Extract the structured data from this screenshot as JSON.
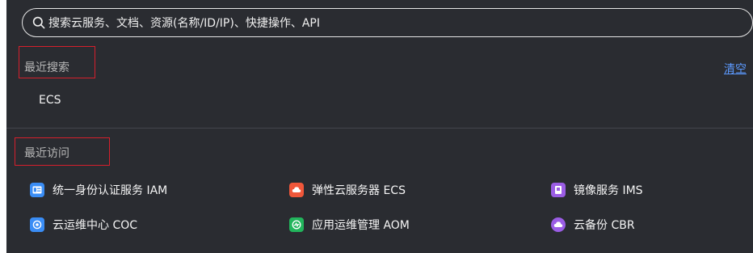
{
  "search": {
    "placeholder": "搜索云服务、文档、资源(名称/ID/IP)、快捷操作、API"
  },
  "recent_search": {
    "title": "最近搜索",
    "clear_label": "清空",
    "items": [
      {
        "label": "ECS"
      }
    ]
  },
  "recent_visit": {
    "title": "最近访问",
    "items": [
      {
        "label": "统一身份认证服务 IAM",
        "icon": "id-card-icon",
        "color": "#3a8df5"
      },
      {
        "label": "弹性云服务器 ECS",
        "icon": "cloud-server-icon",
        "color": "#f0573a"
      },
      {
        "label": "镜像服务 IMS",
        "icon": "image-icon",
        "color": "#9b5de5"
      },
      {
        "label": "云运维中心 COC",
        "icon": "ops-center-icon",
        "color": "#3a8df5"
      },
      {
        "label": "应用运维管理 AOM",
        "icon": "app-monitor-icon",
        "color": "#22b55c"
      },
      {
        "label": "云备份 CBR",
        "icon": "cloud-backup-icon",
        "color": "#9b5de5"
      }
    ]
  },
  "colors": {
    "panel_bg": "#2a2c31",
    "highlight_border": "#d61f2c",
    "link": "#5c9aff"
  }
}
